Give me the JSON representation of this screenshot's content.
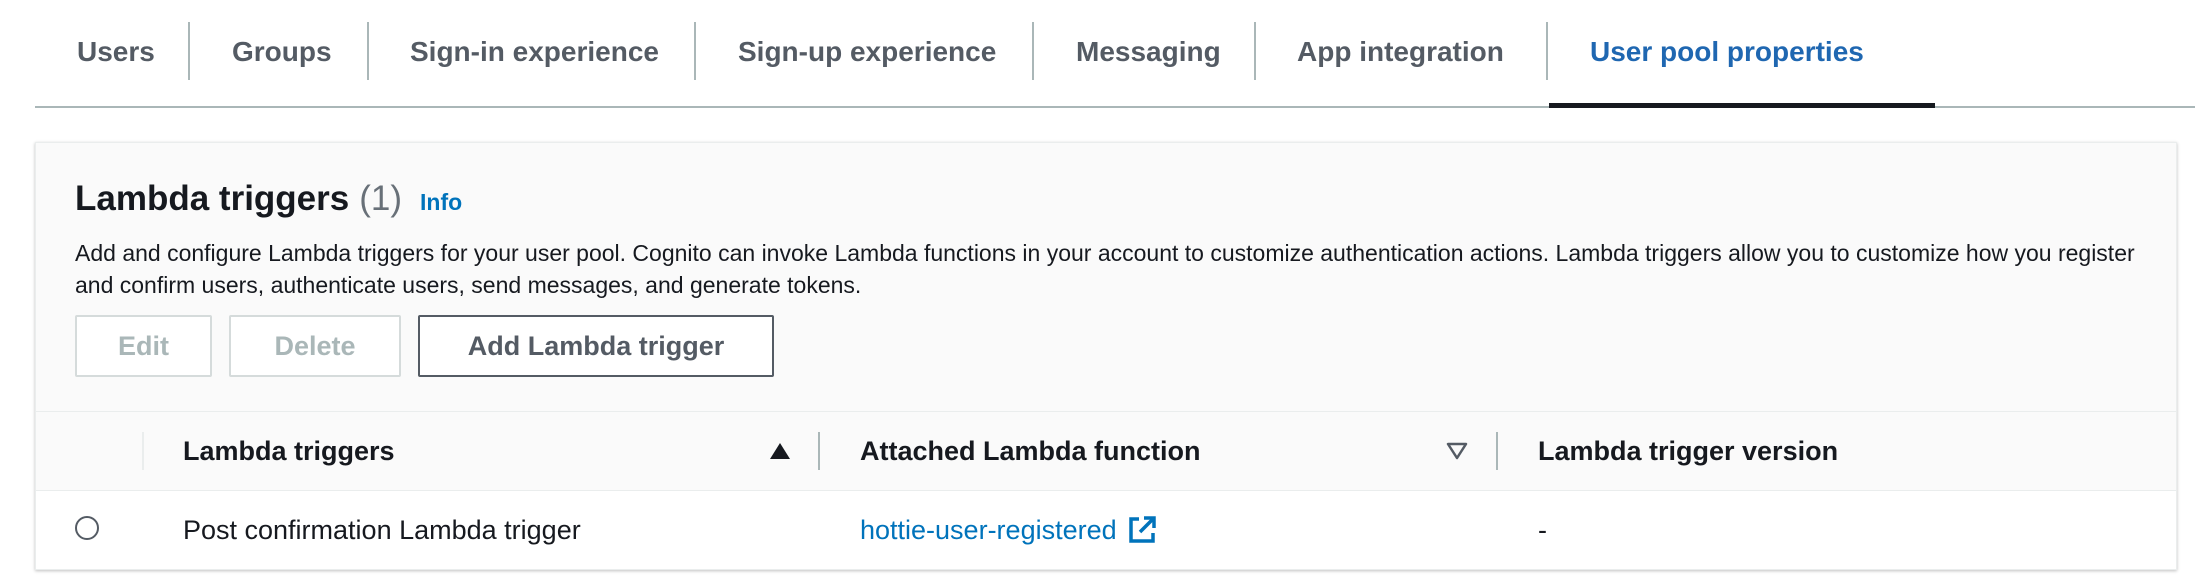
{
  "tabs": [
    {
      "label": "Users",
      "active": false
    },
    {
      "label": "Groups",
      "active": false
    },
    {
      "label": "Sign-in experience",
      "active": false
    },
    {
      "label": "Sign-up experience",
      "active": false
    },
    {
      "label": "Messaging",
      "active": false
    },
    {
      "label": "App integration",
      "active": false
    },
    {
      "label": "User pool properties",
      "active": true
    }
  ],
  "section": {
    "title": "Lambda triggers",
    "count": "(1)",
    "info_label": "Info",
    "description": "Add and configure Lambda triggers for your user pool. Cognito can invoke Lambda functions in your account to customize authentication actions. Lambda triggers allow you to customize how you register and confirm users, authenticate users, send messages, and generate tokens."
  },
  "actions": {
    "edit_label": "Edit",
    "delete_label": "Delete",
    "add_label": "Add Lambda trigger"
  },
  "table": {
    "columns": [
      "Lambda triggers",
      "Attached Lambda function",
      "Lambda trigger version"
    ],
    "rows": [
      {
        "trigger": "Post confirmation Lambda trigger",
        "function": "hottie-user-registered",
        "version": "-"
      }
    ]
  },
  "icons": {
    "sort_ascending": "sort-ascending-icon",
    "sort_descending": "sort-descending-icon",
    "external_link": "external-link-icon"
  },
  "colors": {
    "accent": "#1f67b1",
    "link": "#0073bb",
    "text": "#16191f",
    "muted": "#545b64",
    "disabled": "#aab7b8"
  }
}
